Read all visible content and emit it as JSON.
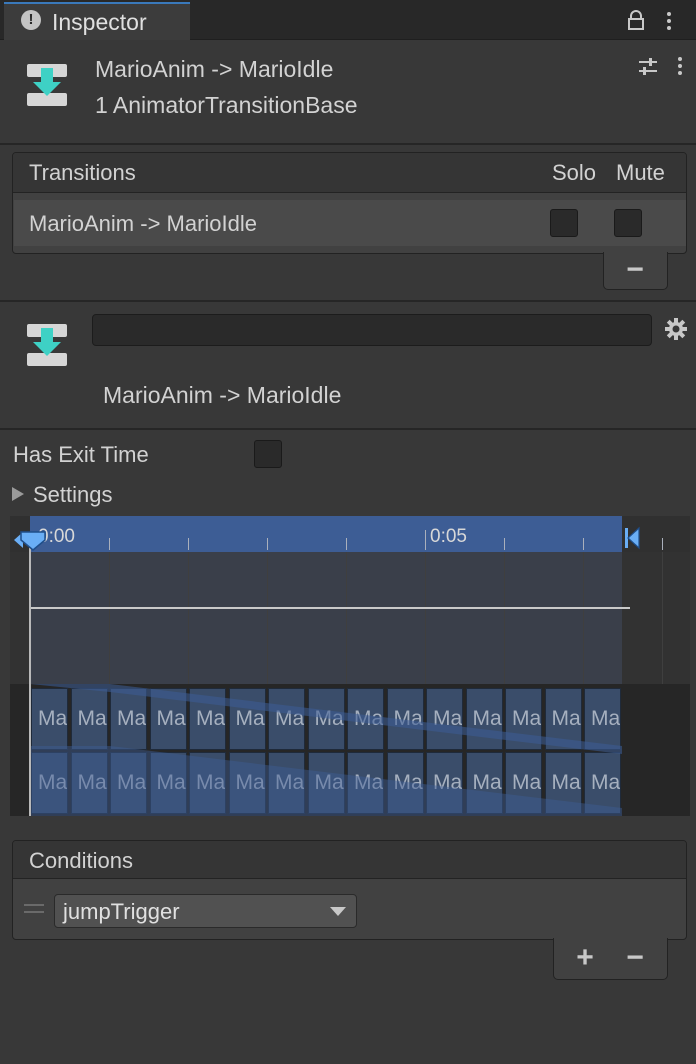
{
  "tab": {
    "title": "Inspector",
    "info_icon": "info-icon",
    "lock_icon": "lock-icon",
    "menu_icon": "kebab-menu-icon"
  },
  "header": {
    "title": "MarioAnim -> MarioIdle",
    "subtitle": "1 AnimatorTransitionBase",
    "icon": "transition-icon"
  },
  "transitions": {
    "header": "Transitions",
    "solo_label": "Solo",
    "mute_label": "Mute",
    "rows": [
      {
        "name": "MarioAnim -> MarioIdle",
        "solo": false,
        "mute": false
      }
    ],
    "remove_label": "−"
  },
  "transition_detail": {
    "name_value": "",
    "label": "MarioAnim -> MarioIdle",
    "gear_icon": "gear-icon"
  },
  "has_exit_time": {
    "label": "Has Exit Time",
    "checked": false
  },
  "settings": {
    "label": "Settings",
    "expanded": false
  },
  "timeline": {
    "tick_labels": [
      "0:00",
      "0:05"
    ],
    "thumbnail_label": "Ma",
    "colors": {
      "ruler_blue": "#3d5d95",
      "clip_blue": "#3a4d6a"
    }
  },
  "conditions": {
    "header": "Conditions",
    "items": [
      {
        "parameter": "jumpTrigger"
      }
    ],
    "add_label": "+",
    "remove_label": "−"
  }
}
